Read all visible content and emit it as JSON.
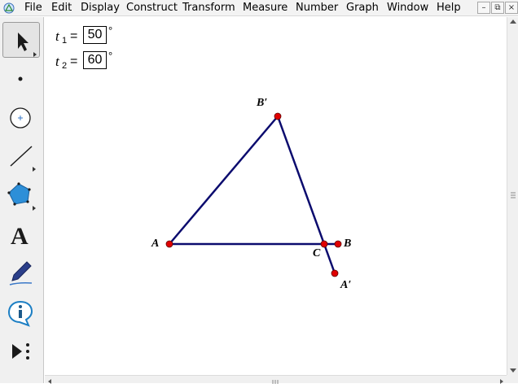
{
  "menu": [
    "File",
    "Edit",
    "Display",
    "Construct",
    "Transform",
    "Measure",
    "Number",
    "Graph",
    "Window",
    "Help"
  ],
  "window_buttons": {
    "minimize": "–",
    "restore": "⧉",
    "close": "×"
  },
  "parameters": [
    {
      "name": "t",
      "sub": "1",
      "equals": "=",
      "value": "50",
      "unit": "°"
    },
    {
      "name": "t",
      "sub": "2",
      "equals": "=",
      "value": "60",
      "unit": "°"
    }
  ],
  "points": {
    "A": "A",
    "B": "B",
    "C": "C",
    "A_prime": "A′",
    "B_prime": "B′"
  },
  "colors": {
    "segment": "#0b0b6e",
    "point": "#e00000",
    "toolbox": "#f0f0f0",
    "menubar": "#f3f3f3"
  },
  "tools": [
    "selection-arrow-icon",
    "point-icon",
    "compass-icon",
    "straightedge-icon",
    "polygon-icon",
    "text-icon",
    "marker-icon",
    "information-icon",
    "custom-tools-icon"
  ]
}
